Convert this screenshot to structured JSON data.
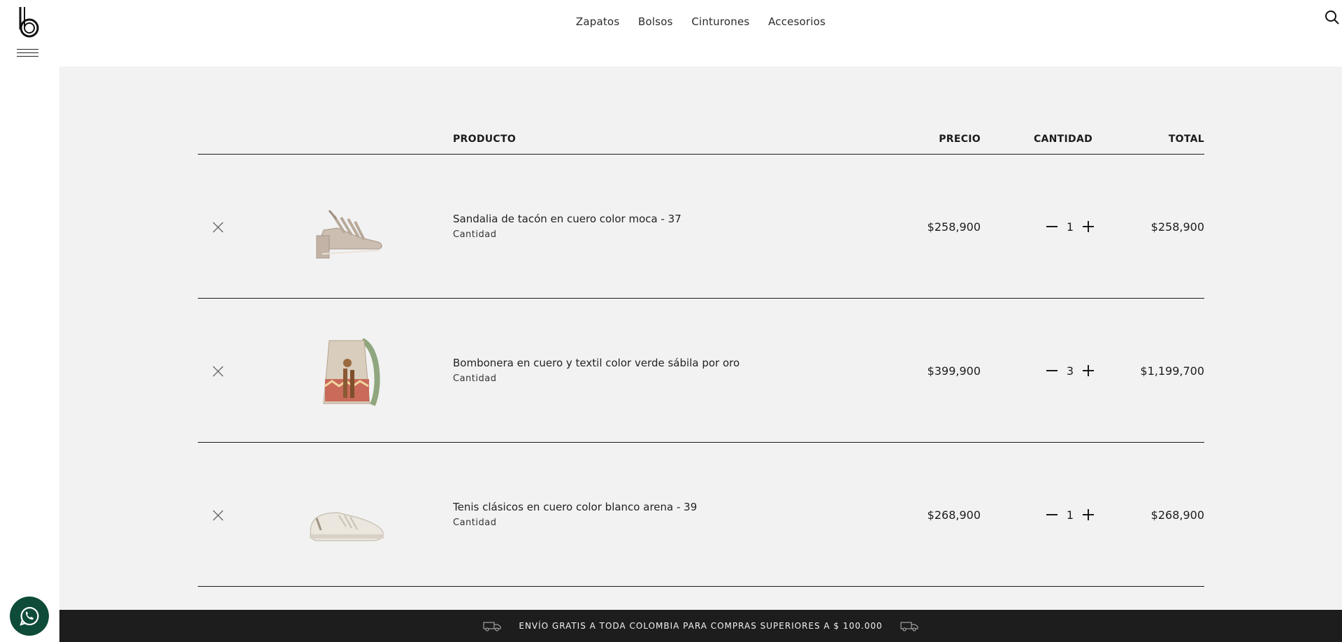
{
  "nav": {
    "items": [
      "Zapatos",
      "Bolsos",
      "Cinturones",
      "Accesorios"
    ]
  },
  "icons": {
    "logo": "brand-logo",
    "menu": "hamburger-menu-icon",
    "search": "search-icon",
    "user": "user-icon",
    "whatsapp": "whatsapp-icon"
  },
  "cart": {
    "headers": {
      "product": "PRODUCTO",
      "price": "PRECIO",
      "quantity": "CANTIDAD",
      "total": "TOTAL"
    },
    "items": [
      {
        "name": "Sandalia de tacón en cuero color moca - 37",
        "label": "Cantidad",
        "price": "$258,900",
        "qty": "1",
        "total": "$258,900"
      },
      {
        "name": "Bombonera en cuero y textil color verde sábila por oro",
        "label": "Cantidad",
        "price": "$399,900",
        "qty": "3",
        "total": "$1,199,700"
      },
      {
        "name": "Tenis clásicos en cuero color blanco arena - 39",
        "label": "Cantidad",
        "price": "$268,900",
        "qty": "1",
        "total": "$268,900"
      }
    ]
  },
  "promo": {
    "text": "ENVÍO GRATIS A TODA COLOMBIA PARA COMPRAS SUPERIORES A $ 100.000"
  },
  "colors": {
    "background": "#f2f2f2",
    "promo_bar": "#1d1d1d",
    "whatsapp": "#0e4b38"
  }
}
